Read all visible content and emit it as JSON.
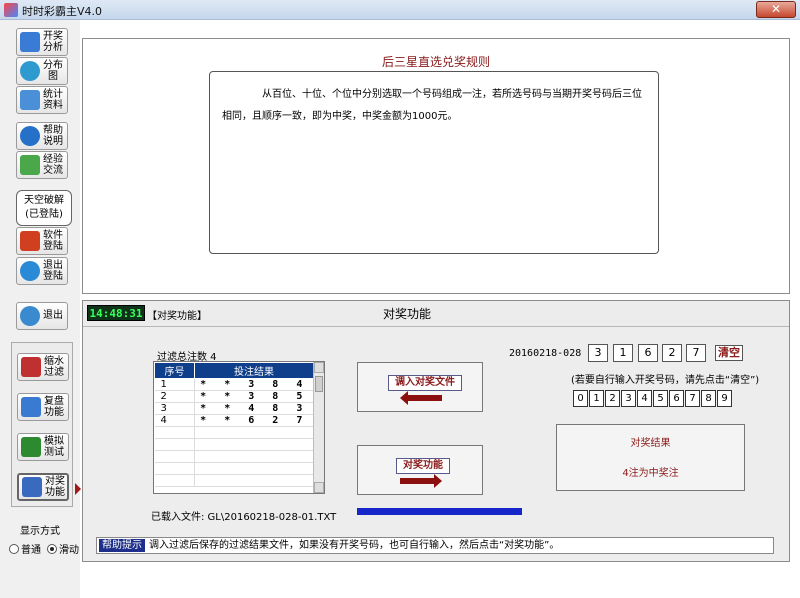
{
  "window": {
    "title": "时时彩霸主V4.0",
    "close_label": "✕"
  },
  "sidebar": {
    "items": [
      {
        "label": "开奖分析",
        "icon": "chart-icon",
        "color": "#3a7bd5"
      },
      {
        "label": "分布图",
        "icon": "globe-icon",
        "color": "#2e9ad0"
      },
      {
        "label": "统计资料",
        "icon": "stats-icon",
        "color": "#4a8fd8"
      },
      {
        "label": "帮助说明",
        "icon": "help-icon",
        "color": "#2670c9"
      },
      {
        "label": "经验交流",
        "icon": "people-icon",
        "color": "#4aa84a"
      },
      {
        "label": "软件登陆",
        "icon": "key-icon",
        "color": "#d04020"
      },
      {
        "label": "退出登陆",
        "icon": "off-icon",
        "color": "#2a8ad6"
      },
      {
        "label": "退出",
        "icon": "exit-icon",
        "color": "#3a8ad0"
      }
    ],
    "login_button": {
      "line1": "天空破解",
      "line2": "(已登陆)"
    },
    "tools": [
      {
        "label": "缩水过滤",
        "icon": "scissors-icon",
        "color": "#c03030"
      },
      {
        "label": "复盘功能",
        "icon": "replay-icon",
        "color": "#3a7ad0"
      },
      {
        "label": "模拟测试",
        "icon": "swap-icon",
        "color": "#2e8a2e"
      },
      {
        "label": "对奖功能",
        "icon": "prize-icon",
        "color": "#3a6ac0"
      }
    ],
    "display_mode": {
      "label": "显示方式",
      "options": [
        "普通",
        "滑动"
      ],
      "selected": "滑动"
    }
  },
  "rules": {
    "title": "后三星直选兑奖规则",
    "text": "从百位、十位、个位中分别选取一个号码组成一注，若所选号码与当期开奖号码后三位相同，且顺序一致，即为中奖，中奖金额为1000元。"
  },
  "prize_panel": {
    "clock": "14:48:31",
    "tag": "【对奖功能】",
    "title": "对奖功能",
    "filter_count_label": "过滤总注数 4",
    "grid": {
      "headers": [
        "序号",
        "投注结果"
      ],
      "rows": [
        {
          "idx": "1",
          "result": "* * 3 8 4"
        },
        {
          "idx": "2",
          "result": "* * 3 8 5"
        },
        {
          "idx": "3",
          "result": "* * 4 8 3"
        },
        {
          "idx": "4",
          "result": "* * 6 2 7"
        }
      ]
    },
    "loaded_file": "已载入文件: GL\\20160218-028-01.TXT",
    "import_button": "调入对奖文件",
    "check_button": "对奖功能",
    "draw_date": "20160218-028",
    "draw_numbers": [
      "3",
      "1",
      "6",
      "2",
      "7"
    ],
    "clear_button": "清空",
    "input_hint": "(若要自行输入开奖号码，请先点击“清空”)",
    "keypad": [
      "0",
      "1",
      "2",
      "3",
      "4",
      "5",
      "6",
      "7",
      "8",
      "9"
    ],
    "result_title": "对奖结果",
    "result_text": "4注为中奖注",
    "progress": 1.0
  },
  "help": {
    "label": "帮助提示",
    "text": "调入过滤后保存的过滤结果文件，如果没有开奖号码，也可自行输入，然后点击“对奖功能”。"
  }
}
